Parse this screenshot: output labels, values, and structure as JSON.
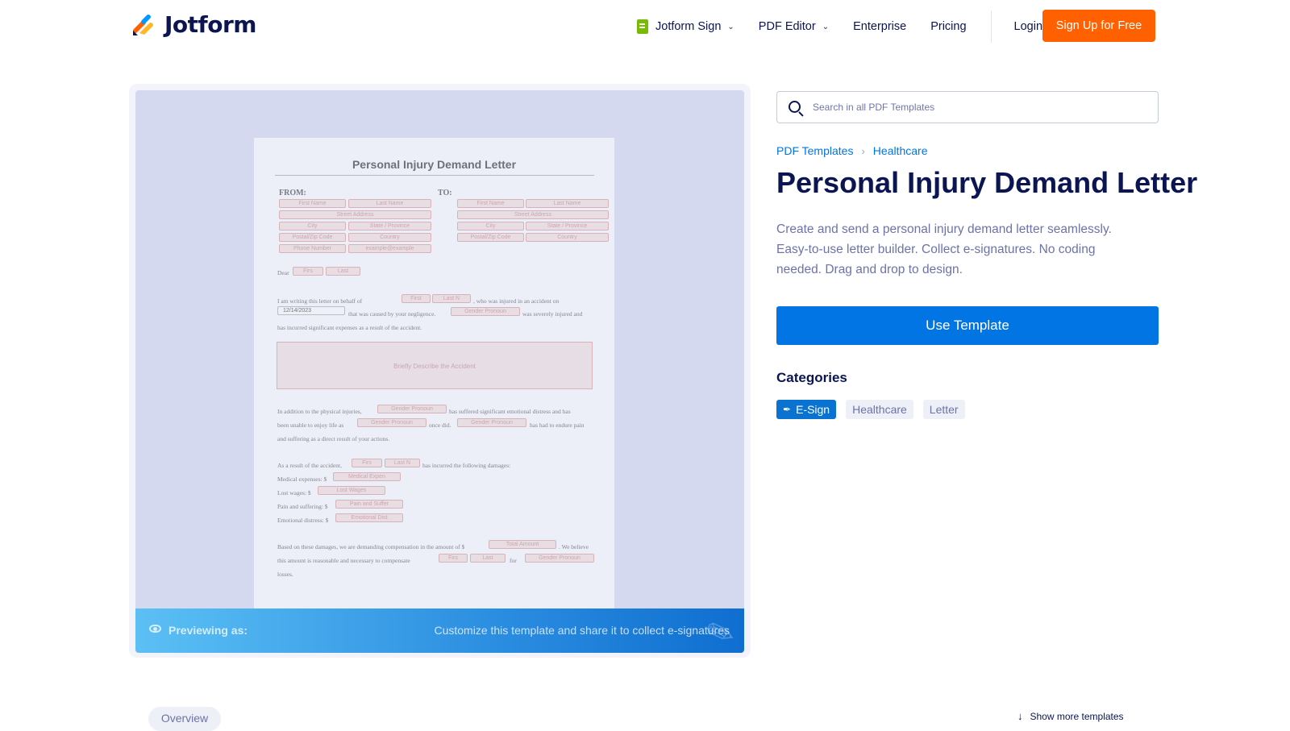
{
  "header": {
    "brand": "Jotform",
    "nav": [
      {
        "label": "Jotform Sign",
        "icon": "document-sign-icon",
        "dropdown": true
      },
      {
        "label": "PDF Editor",
        "dropdown": true
      },
      {
        "label": "Enterprise"
      },
      {
        "label": "Pricing"
      },
      {
        "label": "Login"
      }
    ],
    "signup_label": "Sign Up for Free"
  },
  "preview": {
    "document": {
      "title": "Personal Injury Demand Letter",
      "from_label": "FROM:",
      "to_label": "TO:",
      "from_fields": [
        "First Name",
        "Last Name",
        "Street Address",
        "City",
        "State / Province",
        "Postal/Zip Code",
        "Country",
        "Phone Number",
        "example@example"
      ],
      "to_fields": [
        "First Name",
        "Last Name",
        "Street Address",
        "City",
        "State / Province",
        "Postal/Zip Code",
        "Country"
      ],
      "dear": "Dear",
      "dear_fields": [
        "Firs",
        "Last"
      ],
      "para1": {
        "a": "I am writing this letter on behalf of",
        "name_fields": [
          "First",
          "Last N"
        ],
        "b": ", who was injured in an accident on",
        "date": "12/14/2023",
        "c": "that was caused by your negligence.",
        "pronoun": "Gender Pronoun",
        "d": "was severely injured and",
        "e": "has incurred significant expenses as a result of the accident."
      },
      "accident_placeholder": "Briefly Describe the Accident",
      "para2": {
        "a": "In addition to the physical injuries,",
        "pronoun1": "Gender Pronoun",
        "b": "has suffered significant emotional distress and has",
        "c": "been unable to enjoy life as",
        "pronoun2": "Gender Pronoun",
        "d": "once did.",
        "pronoun3": "Gender Pronoun",
        "e": "has had to endure pain",
        "f": "and suffering as a direct result of your actions."
      },
      "damages": {
        "intro_a": "As a result of the accident,",
        "name_fields": [
          "Firs",
          "Last N"
        ],
        "intro_b": "has incurred the following damages:",
        "rows": [
          {
            "label": "Medical expenses: $",
            "field": "Medical Expen"
          },
          {
            "label": "Lost wages: $",
            "field": "Lost Wages"
          },
          {
            "label": "Pain and suffering: $",
            "field": "Pain and Suffer"
          },
          {
            "label": "Emotional distress: $",
            "field": "Emotional Dist"
          }
        ]
      },
      "closing": {
        "a": "Based on these damages, we are demanding compensation in the amount of $",
        "total": "Total Amount",
        "b": ". We believe",
        "c": "this amount is reasonable and necessary to compensate",
        "name_fields": [
          "Firs",
          "Last"
        ],
        "d": "for",
        "pronoun": "Gender Pronoun",
        "e": "losses."
      }
    },
    "bar": {
      "label": "Previewing as:",
      "message": "Customize this template and share it to collect e-signatures"
    }
  },
  "search": {
    "placeholder": "Search in all PDF Templates",
    "value": ""
  },
  "breadcrumb": [
    "PDF Templates",
    "Healthcare"
  ],
  "title": "Personal Injury Demand Letter",
  "description": "Create and send a personal injury demand letter seamlessly. Easy-to-use letter builder. Collect e-signatures. No coding needed. Drag and drop to design.",
  "use_template_label": "Use Template",
  "categories": {
    "title": "Categories",
    "tags": [
      {
        "label": "E-Sign",
        "active": true,
        "icon": "pen-icon"
      },
      {
        "label": "Healthcare",
        "active": false
      },
      {
        "label": "Letter",
        "active": false
      }
    ]
  },
  "bottom": {
    "overview_label": "Overview",
    "show_more_label": "Show more templates"
  },
  "colors": {
    "brand_orange": "#ff6100",
    "primary_blue": "#0075e3",
    "navy": "#0a1551",
    "esign_blue": "#0a73d1"
  }
}
